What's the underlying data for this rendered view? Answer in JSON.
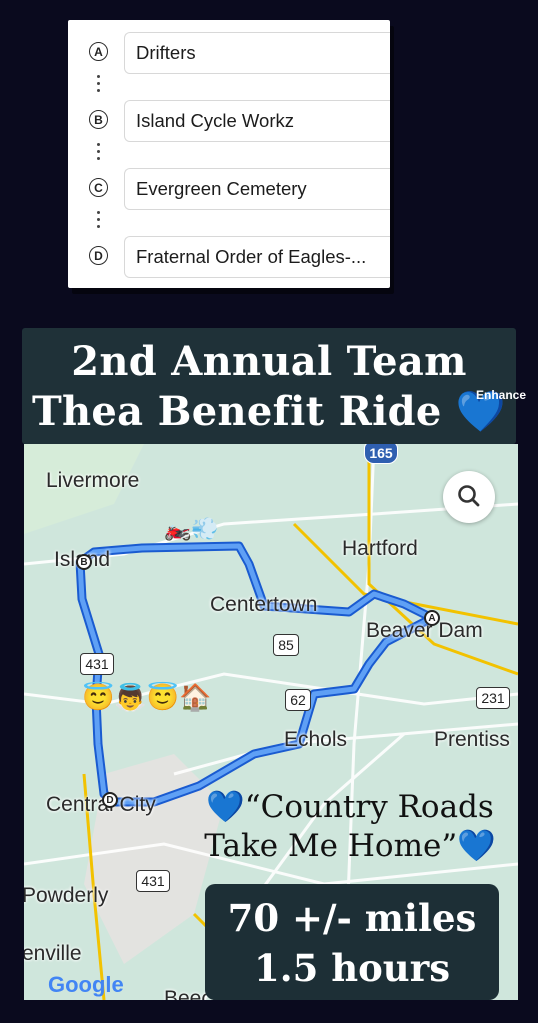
{
  "stops": [
    {
      "marker": "A",
      "label": "Drifters"
    },
    {
      "marker": "B",
      "label": "Island Cycle Workz"
    },
    {
      "marker": "C",
      "label": "Evergreen Cemetery"
    },
    {
      "marker": "D",
      "label": "Fraternal Order of Eagles-..."
    }
  ],
  "title": {
    "line1": "2nd Annual Team",
    "line2": "Thea Benefit Ride",
    "emoji": "💙"
  },
  "enhance_label": "Enhance",
  "map": {
    "places": {
      "livermore": "Livermore",
      "island": "Island",
      "hartford": "Hartford",
      "centertown": "Centertown",
      "beaver_dam": "Beaver Dam",
      "echols": "Echols",
      "prentiss": "Prentiss",
      "central_city": "Central City",
      "powderly": "Powderly",
      "greenville": "enville",
      "beech": "Beech"
    },
    "roads": {
      "i165": "165",
      "us431": "431",
      "r85": "85",
      "r62": "62",
      "us231": "231",
      "us431b": "431"
    },
    "route_markers": {
      "a": "A",
      "b": "B",
      "d": "D"
    },
    "route_color": "#3b7fe0",
    "search_icon": "search-icon",
    "emojis": {
      "moto": "🏍️💨",
      "angels": "😇👼😇🏠"
    }
  },
  "quote": {
    "line1": "💙“Country Roads",
    "line2": "Take Me Home”💙"
  },
  "stats": {
    "distance": "70 +/- miles",
    "duration": "1.5 hours"
  },
  "google_logo": "Google"
}
